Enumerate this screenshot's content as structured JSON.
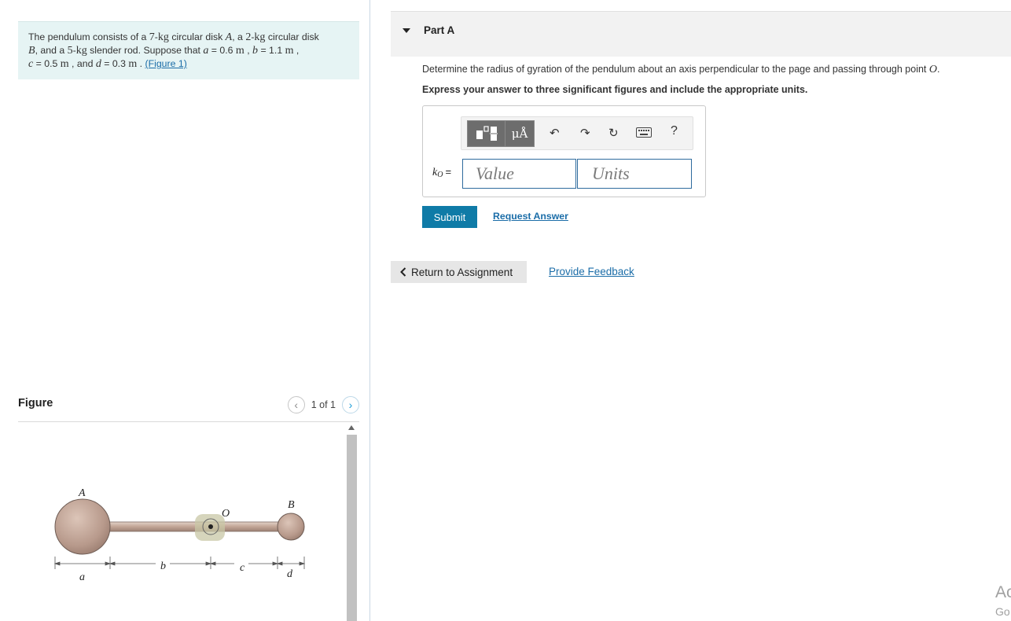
{
  "problem": {
    "t1": "The pendulum consists of a ",
    "m_a": "7",
    "t2": "-",
    "u1": "kg",
    "t3": " circular disk ",
    "v_A": "A",
    "t4": ", a ",
    "m_b": "2",
    "t5": "-",
    "u2": "kg",
    "t6": " circular disk",
    "v_B": "B",
    "t7": ", and a ",
    "m_r": "5",
    "t8": "-",
    "u3": "kg",
    "t9": " slender rod. Suppose that ",
    "v_a": "a",
    "t10": " = 0.6  ",
    "u4": "m",
    "t11": " , ",
    "v_b": "b",
    "t12": " = 1.1  ",
    "u5": "m",
    "t13": " ,",
    "v_c": "c",
    "t14": " = 0.5  ",
    "u6": "m",
    "t15": " , and ",
    "v_d": "d",
    "t16": " = 0.3  ",
    "u7": "m",
    "t17": " . ",
    "figure_link": "(Figure 1)"
  },
  "figure": {
    "title": "Figure",
    "pager_text": "1 of 1",
    "prev_icon": "chevron-left-icon",
    "next_icon": "chevron-right-icon",
    "labels": {
      "A": "A",
      "B": "B",
      "O": "O",
      "a": "a",
      "b": "b",
      "c": "c",
      "d": "d"
    }
  },
  "part": {
    "title": "Part A",
    "question": "Determine the radius of gyration of the pendulum about an axis perpendicular to the page and passing through point ",
    "question_var": "O",
    "question_end": ".",
    "instruction": "Express your answer to three significant figures and include the appropriate units."
  },
  "answer": {
    "var": "k",
    "var_sub": "O",
    "equals": "=",
    "value_placeholder": "Value",
    "units_placeholder": "Units",
    "unit_button": "μÅ",
    "help": "?"
  },
  "buttons": {
    "submit": "Submit",
    "request_answer": "Request Answer",
    "return": "Return to Assignment",
    "provide_feedback": "Provide Feedback"
  },
  "watermark": {
    "line1": "Ac",
    "line2": "Go"
  },
  "colors": {
    "problem_bg": "#e6f4f4",
    "submit_bg": "#0f7ba7",
    "link": "#1b6da8"
  }
}
